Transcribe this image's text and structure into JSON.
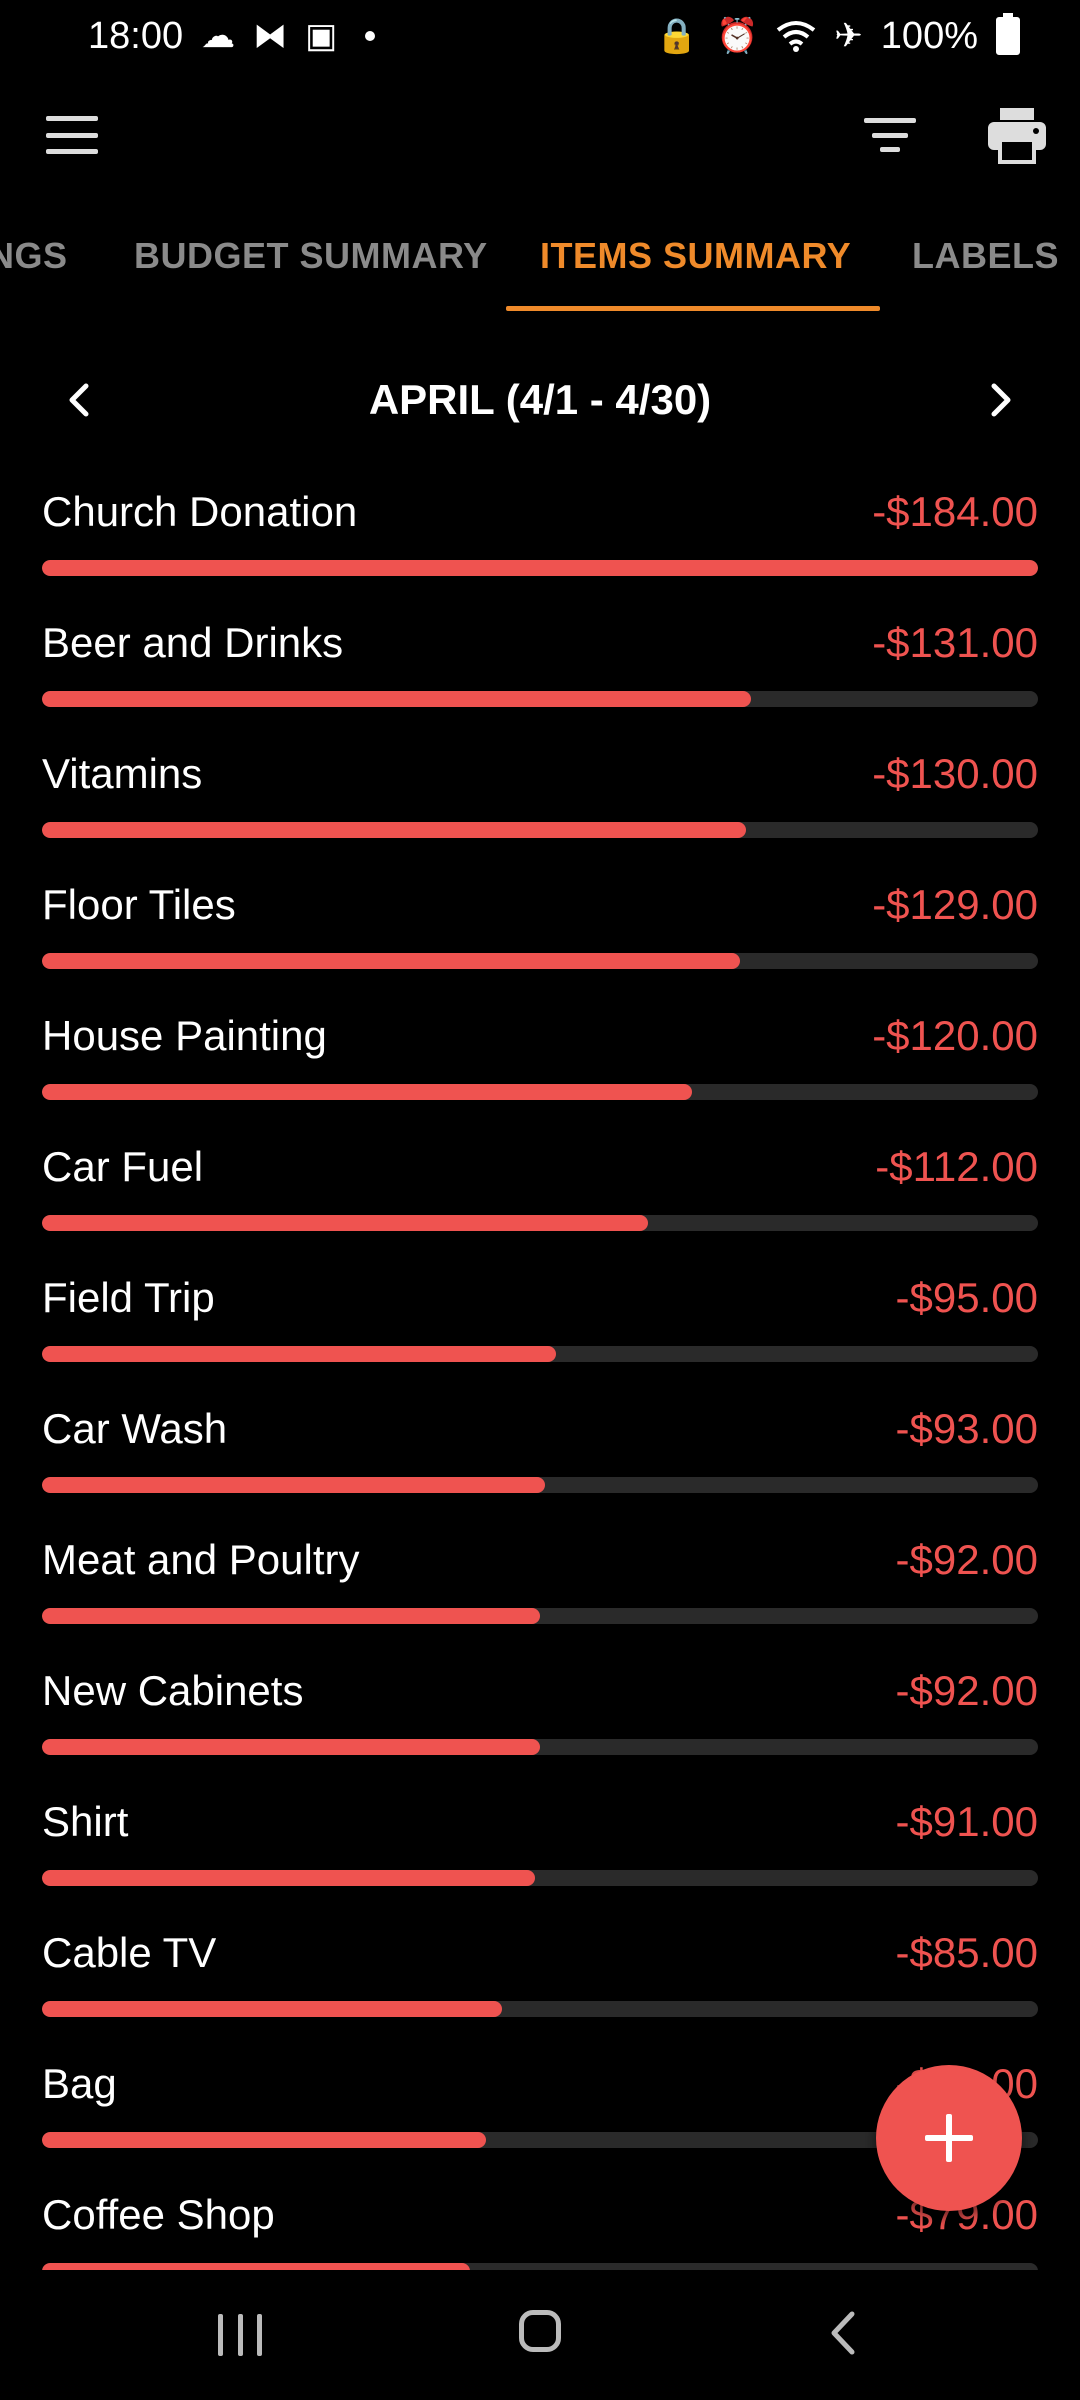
{
  "status_bar": {
    "time": "18:00",
    "battery": "100%"
  },
  "icons": {
    "menu": "hamburger-menu-icon",
    "filter": "filter-icon",
    "print": "printer-icon",
    "prev": "chevron-left-icon",
    "next": "chevron-right-icon",
    "add": "plus-icon"
  },
  "colors": {
    "accent": "#ef8a2a",
    "expense": "#ef5350",
    "track": "#2a2a2a",
    "inactive_tab": "#8a8a8a"
  },
  "tabs": [
    {
      "label": "NGS",
      "active": false
    },
    {
      "label": "BUDGET SUMMARY",
      "active": false
    },
    {
      "label": "ITEMS SUMMARY",
      "active": true
    },
    {
      "label": "LABELS",
      "active": false
    }
  ],
  "period": {
    "title": "APRIL (4/1 - 4/30)"
  },
  "items": [
    {
      "name": "Church Donation",
      "amount": "-$184.00",
      "value": 184
    },
    {
      "name": "Beer and Drinks",
      "amount": "-$131.00",
      "value": 131
    },
    {
      "name": "Vitamins",
      "amount": "-$130.00",
      "value": 130
    },
    {
      "name": "Floor Tiles",
      "amount": "-$129.00",
      "value": 129
    },
    {
      "name": "House Painting",
      "amount": "-$120.00",
      "value": 120
    },
    {
      "name": "Car Fuel",
      "amount": "-$112.00",
      "value": 112
    },
    {
      "name": "Field Trip",
      "amount": "-$95.00",
      "value": 95
    },
    {
      "name": "Car Wash",
      "amount": "-$93.00",
      "value": 93
    },
    {
      "name": "Meat and Poultry",
      "amount": "-$92.00",
      "value": 92
    },
    {
      "name": "New Cabinets",
      "amount": "-$92.00",
      "value": 92
    },
    {
      "name": "Shirt",
      "amount": "-$91.00",
      "value": 91
    },
    {
      "name": "Cable TV",
      "amount": "-$85.00",
      "value": 85
    },
    {
      "name": "Bag",
      "amount": "-$82.00",
      "value": 82
    },
    {
      "name": "Coffee Shop",
      "amount": "-$79.00",
      "value": 79
    }
  ],
  "max_value": 184
}
